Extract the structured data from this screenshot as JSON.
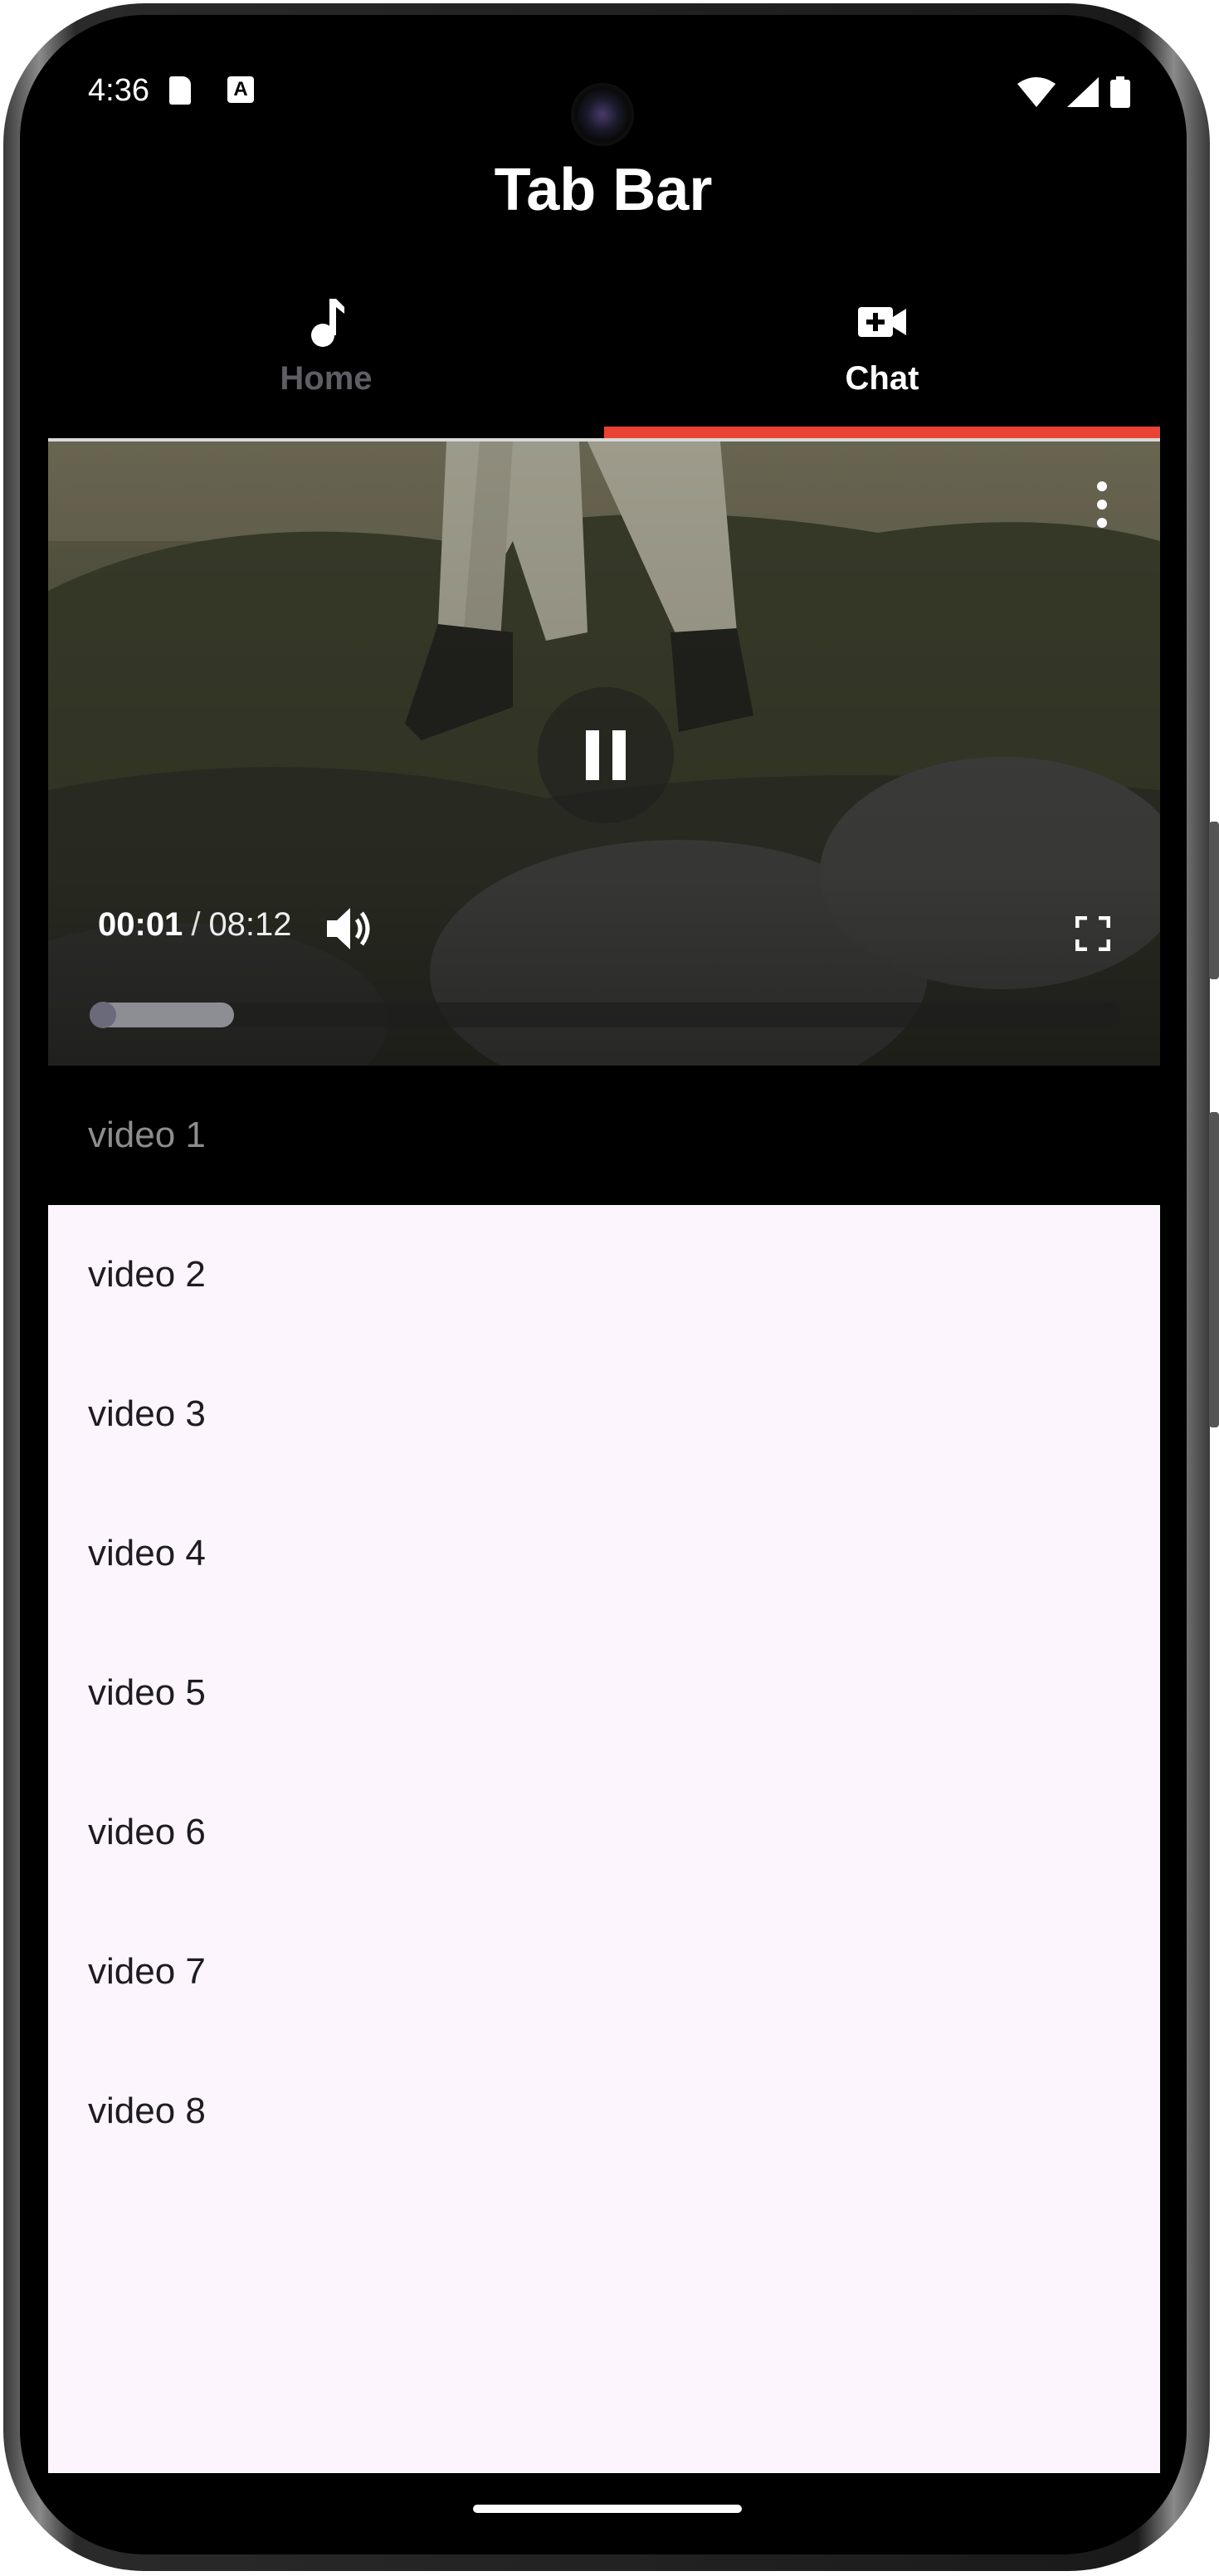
{
  "status_bar": {
    "time": "4:36",
    "icons": [
      "sd-card-icon",
      "font-a-icon",
      "wifi-icon",
      "signal-icon",
      "battery-icon"
    ],
    "a_glyph": "A"
  },
  "app_bar": {
    "title": "Tab Bar"
  },
  "tabs": [
    {
      "label": "Home",
      "icon": "music-note-icon",
      "selected": false
    },
    {
      "label": "Chat",
      "icon": "video-add-icon",
      "selected": true
    }
  ],
  "colors": {
    "indicator": "#ea4335",
    "list_background": "#fdf5fd",
    "selected_row_background": "#000000",
    "inactive_tab_label": "#5e5e64"
  },
  "player": {
    "current_time": "00:01",
    "separator": "/",
    "duration": "08:12",
    "progress_fraction": 0.14,
    "state": "playing",
    "icons": [
      "more-vert-icon",
      "pause-icon",
      "volume-icon",
      "fullscreen-icon"
    ]
  },
  "videos": [
    {
      "label": "video 1",
      "selected": true
    },
    {
      "label": "video 2",
      "selected": false
    },
    {
      "label": "video 3",
      "selected": false
    },
    {
      "label": "video 4",
      "selected": false
    },
    {
      "label": "video 5",
      "selected": false
    },
    {
      "label": "video 6",
      "selected": false
    },
    {
      "label": "video 7",
      "selected": false
    },
    {
      "label": "video 8",
      "selected": false
    }
  ]
}
